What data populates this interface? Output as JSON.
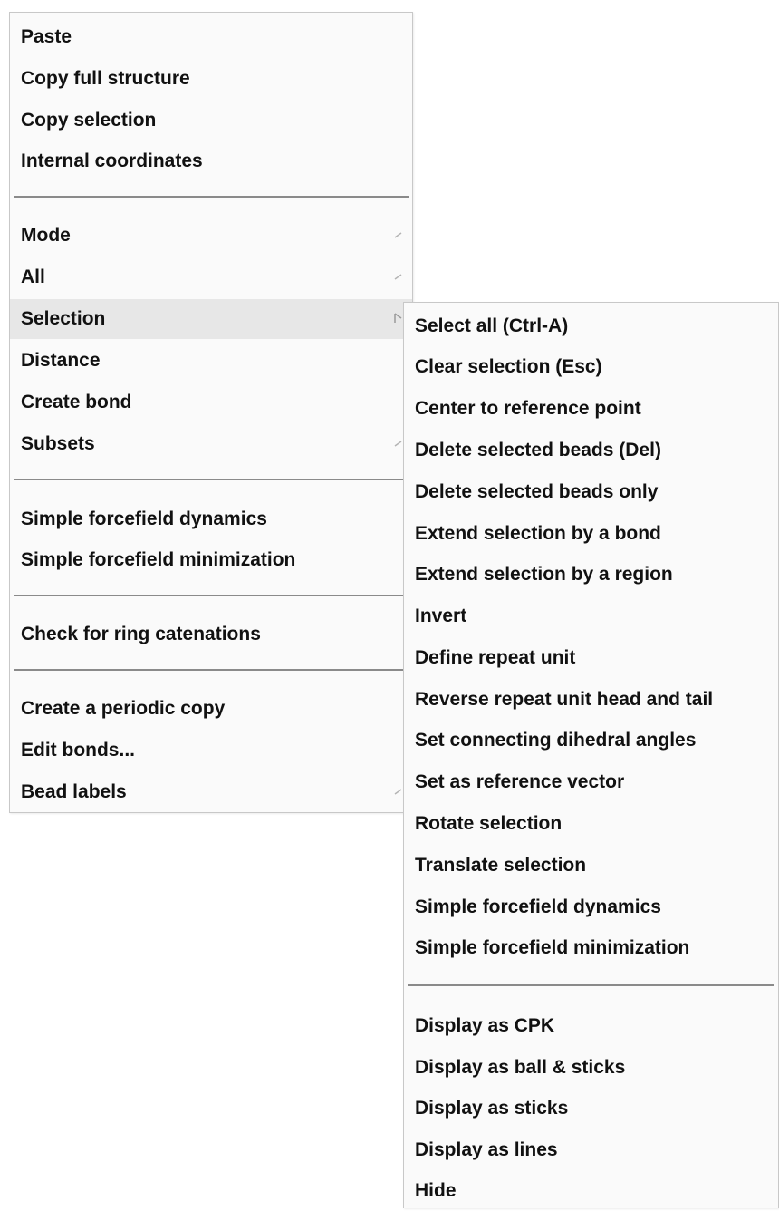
{
  "main_menu": {
    "group1": [
      "Paste",
      "Copy full structure",
      "Copy selection",
      "Internal coordinates"
    ],
    "group2": [
      "Mode",
      "All",
      "Selection",
      "Distance",
      "Create bond",
      "Subsets"
    ],
    "group3": [
      "Simple forcefield dynamics",
      "Simple forcefield minimization"
    ],
    "group4": [
      "Check for ring catenations"
    ],
    "group5": [
      "Create a periodic copy",
      "Edit bonds...",
      "Bead labels"
    ]
  },
  "submenu": {
    "group1": [
      "Select all (Ctrl-A)",
      "Clear selection (Esc)",
      "Center to reference point",
      "Delete selected beads (Del)",
      "Delete selected beads only",
      "Extend selection by a bond",
      "Extend selection by a region",
      "Invert",
      "Define repeat unit",
      "Reverse repeat unit head and tail",
      "Set connecting dihedral angles",
      "Set as reference vector",
      "Rotate selection",
      "Translate selection",
      "Simple forcefield dynamics",
      "Simple forcefield minimization"
    ],
    "group2": [
      "Display as CPK",
      "Display as ball & sticks",
      "Display as sticks",
      "Display as lines",
      "Hide"
    ]
  },
  "icons": {
    "submenu_arrow": "chevron-right-icon"
  },
  "colors": {
    "menu_background": "#fafafa",
    "highlight": "#e7e7e7",
    "separator": "#8a8a8a",
    "text": "#111111"
  }
}
